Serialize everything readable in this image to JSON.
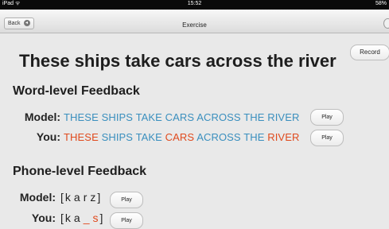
{
  "status_bar": {
    "carrier": "iPad",
    "wifi": "ᯤ",
    "time": "15:52",
    "battery": "58%"
  },
  "nav": {
    "back_label": "Back",
    "title": "Exercise"
  },
  "headline": "These ships take cars across the river",
  "record_label": "Record",
  "word_feedback": {
    "title": "Word-level Feedback",
    "model_label": "Model:",
    "you_label": "You:",
    "model_words": [
      {
        "text": "THESE",
        "error": false
      },
      {
        "text": "SHIPS",
        "error": false
      },
      {
        "text": "TAKE",
        "error": false
      },
      {
        "text": "CARS",
        "error": false
      },
      {
        "text": "ACROSS",
        "error": false
      },
      {
        "text": "THE",
        "error": false
      },
      {
        "text": "RIVER",
        "error": false
      }
    ],
    "you_words": [
      {
        "text": "THESE",
        "error": true
      },
      {
        "text": "SHIPS",
        "error": false
      },
      {
        "text": "TAKE",
        "error": false
      },
      {
        "text": "CARS",
        "error": true
      },
      {
        "text": "ACROSS",
        "error": false
      },
      {
        "text": "THE",
        "error": false
      },
      {
        "text": "RIVER",
        "error": true
      }
    ],
    "play_label": "Play"
  },
  "phone_feedback": {
    "title": "Phone-level Feedback",
    "model_label": "Model:",
    "you_label": "You:",
    "bracket_open": "[",
    "bracket_close": "]",
    "model_phones": [
      {
        "text": "k",
        "error": false
      },
      {
        "text": "a",
        "error": false
      },
      {
        "text": "r",
        "error": false
      },
      {
        "text": "z",
        "error": false
      }
    ],
    "you_phones": [
      {
        "text": "k",
        "error": false
      },
      {
        "text": "a",
        "error": false
      },
      {
        "text": "_",
        "error": true
      },
      {
        "text": "s",
        "error": true
      }
    ],
    "play_label": "Play"
  },
  "colors": {
    "correct": "#3a8fbe",
    "error": "#e04a1d"
  }
}
